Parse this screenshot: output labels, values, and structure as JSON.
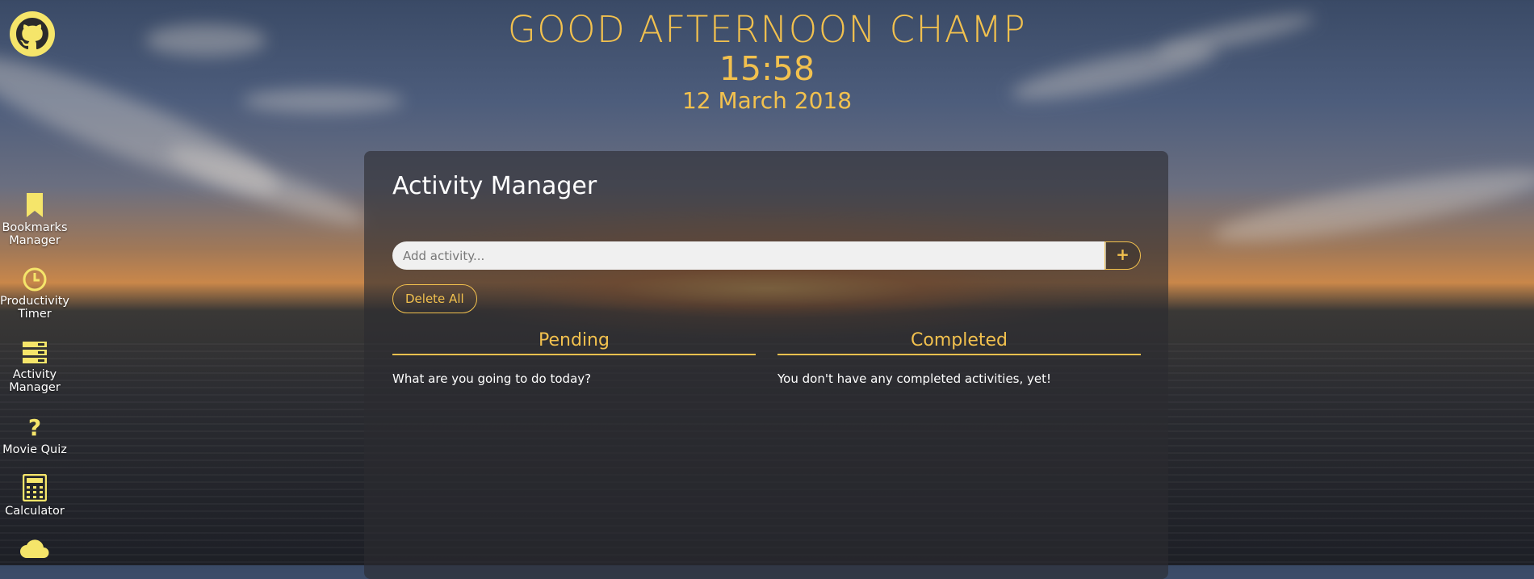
{
  "greeting": {
    "message": "GOOD AFTERNOON CHAMP",
    "time": "15:58",
    "date": "12 March 2018"
  },
  "sidebar": {
    "logo_icon": "github-icon",
    "items": [
      {
        "label": "Bookmarks\nManager",
        "icon": "bookmark-icon"
      },
      {
        "label": "Productivity\nTimer",
        "icon": "clock-icon"
      },
      {
        "label": "Activity\nManager",
        "icon": "list-icon"
      },
      {
        "label": "Movie Quiz",
        "icon": "question-icon"
      },
      {
        "label": "Calculator",
        "icon": "calculator-icon"
      },
      {
        "label": "",
        "icon": "cloud-icon"
      }
    ]
  },
  "activity_manager": {
    "title": "Activity Manager",
    "input_placeholder": "Add activity...",
    "add_button": "+",
    "delete_all": "Delete All",
    "pending": {
      "heading": "Pending",
      "empty_message": "What are you going to do today?"
    },
    "completed": {
      "heading": "Completed",
      "empty_message": "You don't have any completed activities, yet!"
    }
  },
  "colors": {
    "accent": "#f2c14e",
    "icon": "#f5e56a",
    "panel": "rgba(44,44,48,0.62)"
  }
}
